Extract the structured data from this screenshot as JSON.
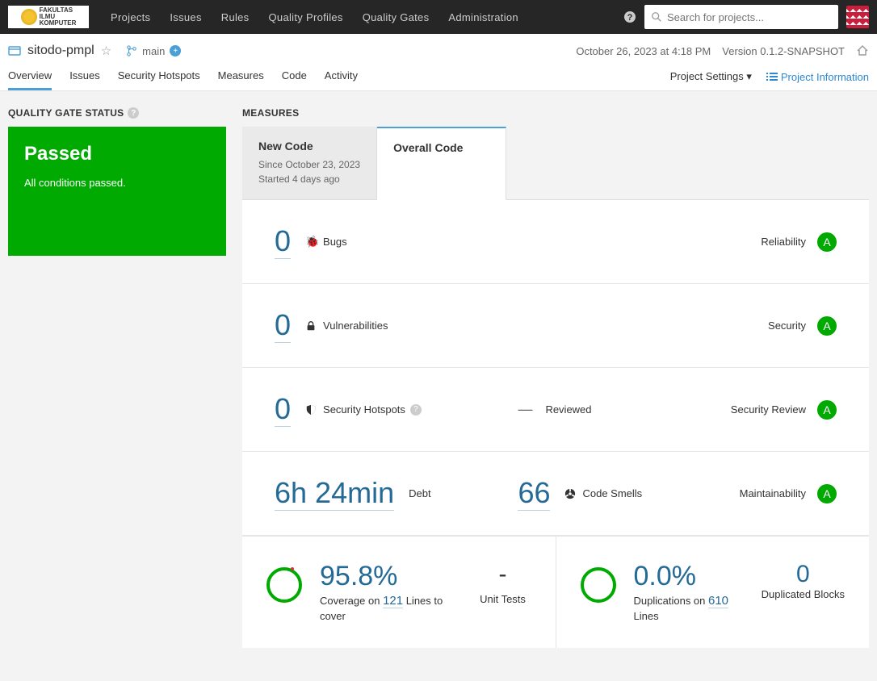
{
  "topnav": {
    "items": [
      "Projects",
      "Issues",
      "Rules",
      "Quality Profiles",
      "Quality Gates",
      "Administration"
    ],
    "search_placeholder": "Search for projects..."
  },
  "project": {
    "name": "sitodo-pmpl",
    "branch": "main",
    "last_analysis": "October 26, 2023 at 4:18 PM",
    "version": "Version 0.1.2-SNAPSHOT",
    "tabs": [
      "Overview",
      "Issues",
      "Security Hotspots",
      "Measures",
      "Code",
      "Activity"
    ],
    "settings_label": "Project Settings",
    "info_label": "Project Information"
  },
  "sidebar": {
    "title": "QUALITY GATE STATUS",
    "status": "Passed",
    "desc": "All conditions passed."
  },
  "main": {
    "title": "MEASURES",
    "tabs": {
      "new": {
        "title": "New Code",
        "line1": "Since October 23, 2023",
        "line2": "Started 4 days ago"
      },
      "overall": {
        "title": "Overall Code"
      }
    }
  },
  "measures": {
    "bugs": {
      "value": "0",
      "label": "Bugs",
      "category": "Reliability",
      "rating": "A"
    },
    "vulns": {
      "value": "0",
      "label": "Vulnerabilities",
      "category": "Security",
      "rating": "A"
    },
    "hotspots": {
      "value": "0",
      "label": "Security Hotspots",
      "reviewed_dash": "—",
      "reviewed_label": "Reviewed",
      "category": "Security Review",
      "rating": "A"
    },
    "debt": {
      "value": "6h 24min",
      "label": "Debt",
      "smells_value": "66",
      "smells_label": "Code Smells",
      "category": "Maintainability",
      "rating": "A"
    }
  },
  "coverage": {
    "pct": "95.8%",
    "prefix": "Coverage on ",
    "lines": "121",
    "suffix": " Lines to cover",
    "tests_value": "-",
    "tests_label": "Unit Tests"
  },
  "duplication": {
    "pct": "0.0%",
    "prefix": "Duplications on ",
    "lines": "610",
    "suffix": " Lines",
    "blocks_value": "0",
    "blocks_label": "Duplicated Blocks"
  }
}
